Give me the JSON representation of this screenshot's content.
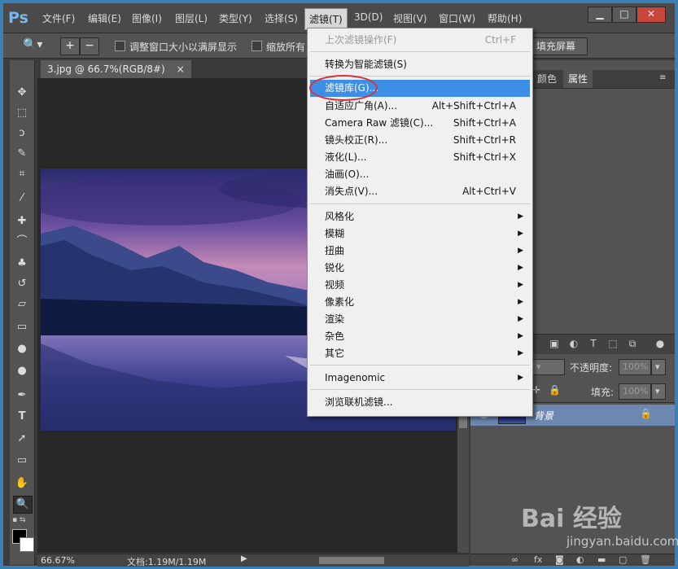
{
  "app": {
    "logo": "Ps"
  },
  "menubar": {
    "items": [
      "文件(F)",
      "编辑(E)",
      "图像(I)",
      "图层(L)",
      "类型(Y)",
      "选择(S)",
      "滤镜(T)",
      "3D(D)",
      "视图(V)",
      "窗口(W)",
      "帮助(H)"
    ],
    "active_item": "滤镜(T)",
    "window_buttons": {
      "minimize": "▁",
      "maximize": "□",
      "close": "✕"
    }
  },
  "options_bar": {
    "zoom_in_icon": "+",
    "zoom_out_icon": "−",
    "check1_label": "调整窗口大小以满屏显示",
    "check2_label": "缩放所有",
    "fill_screen_label": "填充屏幕"
  },
  "document": {
    "tab_label": "3.jpg @ 66.7%(RGB/8#)",
    "tab_close": "×"
  },
  "status": {
    "zoom": "66.67%",
    "doc_info": "文档:1.19M/1.19M"
  },
  "panels": {
    "tabs": [
      "颜色",
      "属性"
    ],
    "active_tab": "属性",
    "opacity_label": "不透明度:",
    "opacity_value": "100%",
    "fill_label": "填充:",
    "fill_value": "100%",
    "layer_name": "背景"
  },
  "filter_menu": {
    "items": [
      {
        "label": "上次滤镜操作(F)",
        "shortcut": "Ctrl+F",
        "disabled": true
      },
      {
        "label": "转换为智能滤镜(S)",
        "shortcut": ""
      },
      {
        "label": "滤镜库(G)...",
        "shortcut": "",
        "highlighted": true
      },
      {
        "label": "自适应广角(A)...",
        "shortcut": "Alt+Shift+Ctrl+A"
      },
      {
        "label": "Camera Raw 滤镜(C)...",
        "shortcut": "Shift+Ctrl+A"
      },
      {
        "label": "镜头校正(R)...",
        "shortcut": "Shift+Ctrl+R"
      },
      {
        "label": "液化(L)...",
        "shortcut": "Shift+Ctrl+X"
      },
      {
        "label": "油画(O)...",
        "shortcut": ""
      },
      {
        "label": "消失点(V)...",
        "shortcut": "Alt+Ctrl+V"
      },
      {
        "label": "风格化",
        "submenu": true
      },
      {
        "label": "模糊",
        "submenu": true
      },
      {
        "label": "扭曲",
        "submenu": true
      },
      {
        "label": "锐化",
        "submenu": true
      },
      {
        "label": "视频",
        "submenu": true
      },
      {
        "label": "像素化",
        "submenu": true
      },
      {
        "label": "渲染",
        "submenu": true
      },
      {
        "label": "杂色",
        "submenu": true
      },
      {
        "label": "其它",
        "submenu": true
      },
      {
        "label": "Imagenomic",
        "submenu": true
      },
      {
        "label": "浏览联机滤镜...",
        "shortcut": ""
      }
    ]
  },
  "watermark": {
    "brand": "Bai 经验",
    "url": "jingyan.baidu.com"
  },
  "colors": {
    "accent_highlight": "#3d8ee6",
    "annotation_circle": "#d8313a",
    "layer_selected": "#6c87b0"
  }
}
